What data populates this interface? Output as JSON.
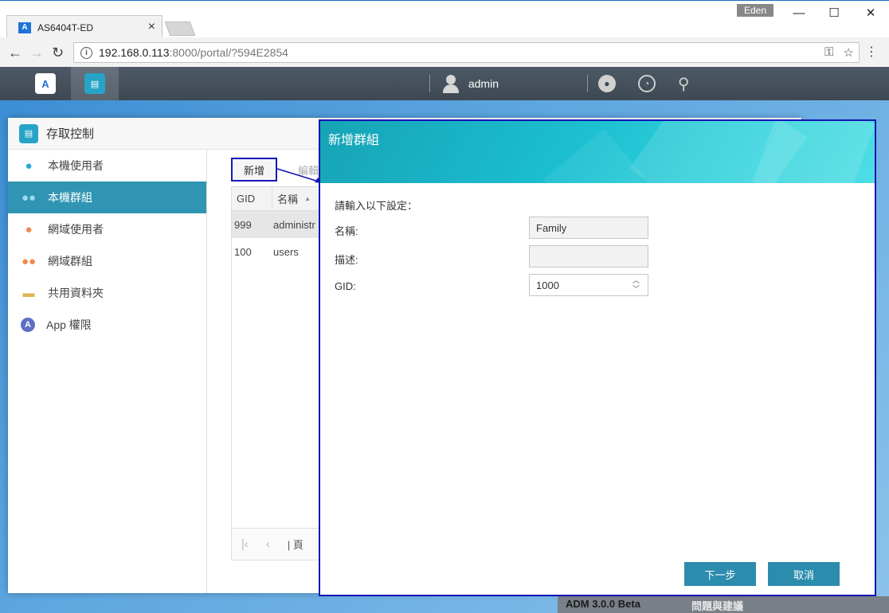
{
  "browser": {
    "tab_title": "AS6404T-ED",
    "favicon_label": "A",
    "profile_name": "Eden",
    "url_host": "192.168.0.113",
    "url_rest": ":8000/portal/?594E2854"
  },
  "adm": {
    "user": "admin",
    "icons": [
      "adm-logo-icon",
      "access-control-icon",
      "user-icon",
      "notification-icon",
      "dashboard-icon",
      "search-icon"
    ]
  },
  "window": {
    "title": "存取控制",
    "sidebar": [
      {
        "label": "本機使用者",
        "icon": "👤",
        "active": false
      },
      {
        "label": "本機群組",
        "icon": "👥",
        "active": true
      },
      {
        "label": "網域使用者",
        "icon": "👤",
        "active": false
      },
      {
        "label": "網域群組",
        "icon": "👥",
        "active": false
      },
      {
        "label": "共用資料夾",
        "icon": "📁",
        "active": false
      },
      {
        "label": "App 權限",
        "icon": "A",
        "active": false
      }
    ],
    "toolbar": {
      "add_label": "新增",
      "edit_label": "編輯"
    },
    "grid": {
      "headers": [
        "GID",
        "名稱"
      ],
      "rows": [
        {
          "gid": "999",
          "name": "administr"
        },
        {
          "gid": "100",
          "name": "users"
        }
      ]
    },
    "pager_text": "頁"
  },
  "dialog": {
    "title": "新增群組",
    "prompt": "請輸入以下設定：",
    "name_label": "名稱:",
    "name_value": "Family",
    "desc_label": "描述:",
    "desc_value": "",
    "gid_label": "GID:",
    "gid_value": "1000",
    "next_label": "下一步",
    "cancel_label": "取消"
  },
  "background": {
    "bottom_left_text": "ADM 3.0.0 Beta",
    "bottom_right_text": "問題與建議"
  },
  "colors": {
    "accent": "#2b8cae",
    "active_sidebar": "#2f95b2",
    "annotation_border": "#1414b4",
    "dialog_header": "#1bbfd0"
  }
}
